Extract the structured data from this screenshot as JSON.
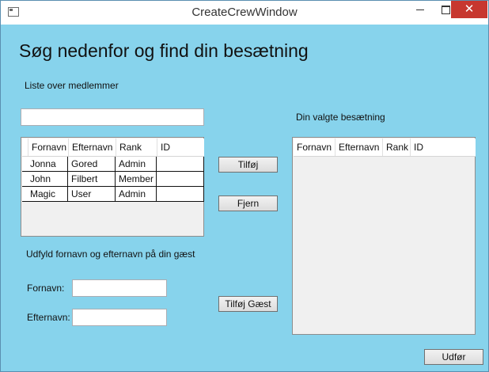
{
  "window": {
    "title": "CreateCrewWindow"
  },
  "heading": "Søg nedenfor og find din besætning",
  "members": {
    "label": "Liste over medlemmer",
    "search_value": "",
    "columns": [
      "Fornavn",
      "Efternavn",
      "Rank",
      "ID"
    ],
    "rows": [
      [
        "Jonna",
        "Gored",
        "Admin",
        ""
      ],
      [
        "John",
        "Filbert",
        "Member",
        ""
      ],
      [
        "Magic",
        "User",
        "Admin",
        ""
      ]
    ]
  },
  "actions": {
    "add": "Tilføj",
    "remove": "Fjern",
    "add_guest": "Tilføj Gæst",
    "done": "Udfør"
  },
  "crew": {
    "label": "Din valgte besætning",
    "columns": [
      "Fornavn",
      "Efternavn",
      "Rank",
      "ID"
    ]
  },
  "guest": {
    "label": "Udfyld fornavn og efternavn på din gæst",
    "first_name_label": "Fornavn:",
    "first_name_value": "",
    "last_name_label": "Efternavn:",
    "last_name_value": ""
  }
}
